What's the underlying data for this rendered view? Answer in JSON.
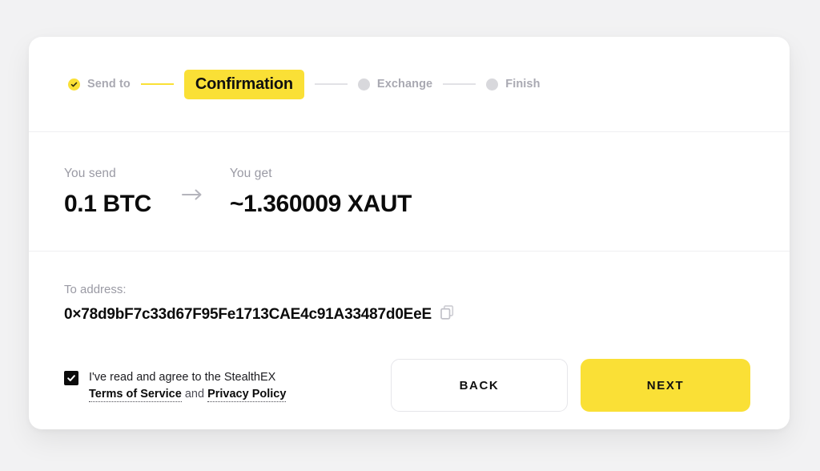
{
  "theme": {
    "accent": "#fae036",
    "page_bg": "#f2f2f3",
    "card_bg": "#ffffff",
    "text_primary": "#0b0b0b",
    "text_muted": "#9a9aa4",
    "divider": "#efeff1"
  },
  "stepper": {
    "steps": [
      {
        "label": "Send to",
        "state": "done",
        "icon": "check-circle-icon"
      },
      {
        "label": "Confirmation",
        "state": "current"
      },
      {
        "label": "Exchange",
        "state": "pending",
        "icon": "dot-icon"
      },
      {
        "label": "Finish",
        "state": "pending",
        "icon": "dot-icon"
      }
    ]
  },
  "amounts": {
    "send_label": "You send",
    "send_value": "0.1 BTC",
    "arrow_icon": "arrow-right-icon",
    "get_label": "You get",
    "get_value": "~1.360009 XAUT"
  },
  "address": {
    "label": "To address:",
    "value": "0×78d9bF7c33d67F95Fe1713CAE4c91A33487d0EeE",
    "copy_icon": "copy-icon"
  },
  "agreement": {
    "checked": true,
    "line1": "I've read and agree to the StealthEX",
    "terms_link": "Terms of Service",
    "conjunction": "and",
    "privacy_link": "Privacy Policy"
  },
  "actions": {
    "back_label": "BACK",
    "next_label": "NEXT"
  }
}
